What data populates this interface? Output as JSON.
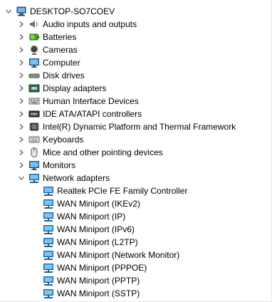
{
  "tree": {
    "root": {
      "label": "DESKTOP-SO7COEV",
      "icon": "computer-icon",
      "expanded": true
    },
    "categories": [
      {
        "label": "Audio inputs and outputs",
        "icon": "speaker-icon"
      },
      {
        "label": "Batteries",
        "icon": "battery-icon"
      },
      {
        "label": "Cameras",
        "icon": "camera-icon"
      },
      {
        "label": "Computer",
        "icon": "monitor-icon"
      },
      {
        "label": "Disk drives",
        "icon": "disk-drive-icon"
      },
      {
        "label": "Display adapters",
        "icon": "display-adapter-icon"
      },
      {
        "label": "Human Interface Devices",
        "icon": "hid-icon"
      },
      {
        "label": "IDE ATA/ATAPI controllers",
        "icon": "ide-controller-icon"
      },
      {
        "label": "Intel(R) Dynamic Platform and Thermal Framework",
        "icon": "chip-icon"
      },
      {
        "label": "Keyboards",
        "icon": "keyboard-icon"
      },
      {
        "label": "Mice and other pointing devices",
        "icon": "mouse-icon"
      },
      {
        "label": "Monitors",
        "icon": "monitor-icon"
      },
      {
        "label": "Network adapters",
        "icon": "network-adapter-icon",
        "expanded": true
      }
    ],
    "network_adapters": [
      "Realtek PCIe FE Family Controller",
      "WAN Miniport (IKEv2)",
      "WAN Miniport (IP)",
      "WAN Miniport (IPv6)",
      "WAN Miniport (L2TP)",
      "WAN Miniport (Network Monitor)",
      "WAN Miniport (PPPOE)",
      "WAN Miniport (PPTP)",
      "WAN Miniport (SSTP)"
    ],
    "colors": {
      "accent": "#1e88c8",
      "chevron": "#555555"
    }
  }
}
